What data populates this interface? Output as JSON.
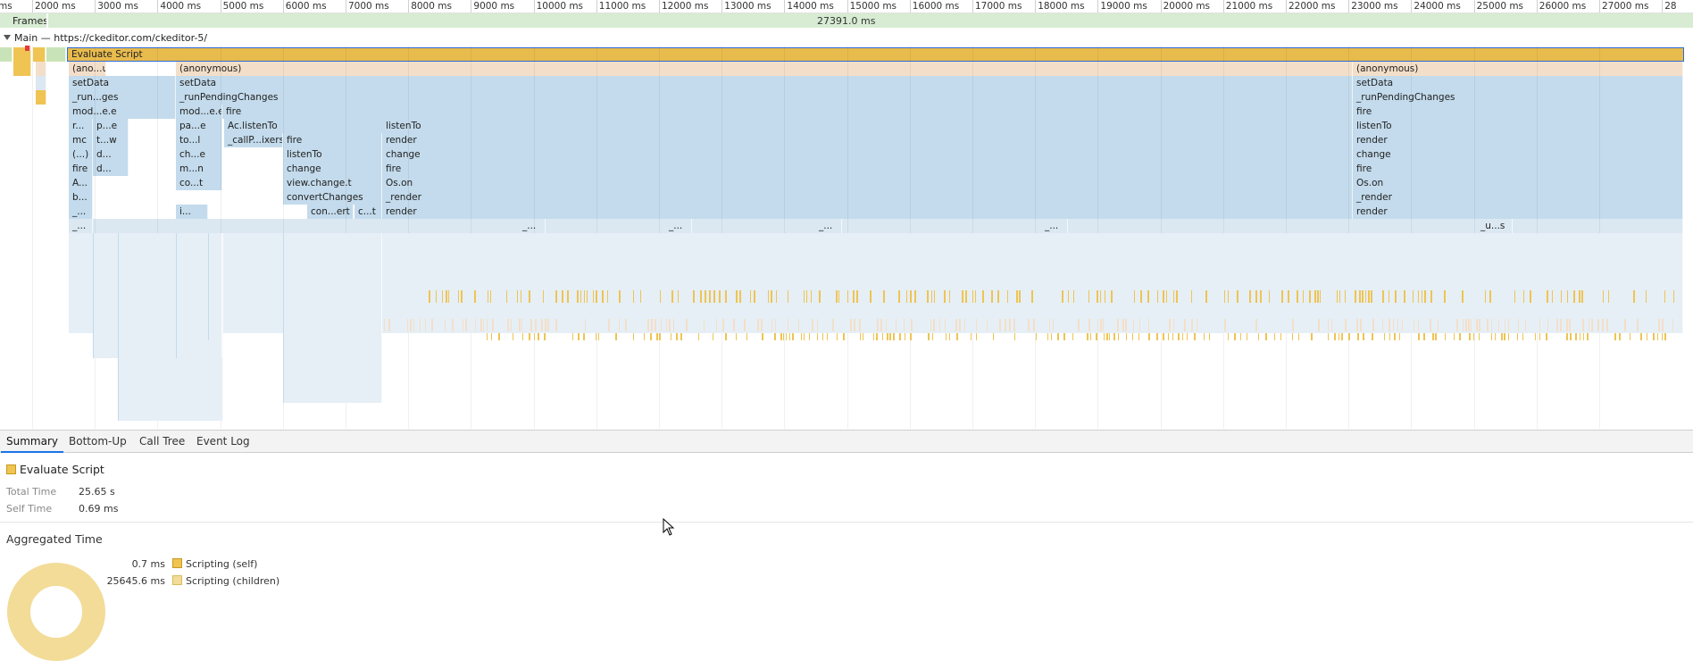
{
  "ruler": {
    "ticks": [
      "ms",
      "2000 ms",
      "3000 ms",
      "4000 ms",
      "5000 ms",
      "6000 ms",
      "7000 ms",
      "8000 ms",
      "9000 ms",
      "10000 ms",
      "11000 ms",
      "12000 ms",
      "13000 ms",
      "14000 ms",
      "15000 ms",
      "16000 ms",
      "17000 ms",
      "18000 ms",
      "19000 ms",
      "20000 ms",
      "21000 ms",
      "22000 ms",
      "23000 ms",
      "24000 ms",
      "25000 ms",
      "26000 ms",
      "27000 ms",
      "28"
    ]
  },
  "frames": {
    "label": "Frames",
    "duration": "27391.0 ms"
  },
  "main": {
    "label": "Main — https://ckeditor.com/ckeditor-5/"
  },
  "flame": {
    "evaluate_script": "Evaluate Script",
    "rows": [
      [
        "(ano...us)",
        "(anonymous)",
        "(anonymous)"
      ],
      [
        "setData",
        "setData",
        "setData"
      ],
      [
        "_run...ges",
        "_runPendingChanges",
        "_runPendingChanges"
      ],
      [
        "mod...e.e",
        "mod...e.e",
        "fire",
        "fire"
      ],
      [
        "r...",
        "p...e",
        "pa...e",
        "Ac.listenTo",
        "listenTo",
        "listenTo"
      ],
      [
        "mc",
        "t...w",
        "to...l",
        "_callP...ixers",
        "fire",
        "render",
        "render"
      ],
      [
        "(...)",
        "d...",
        "ch...e",
        "listenTo",
        "change",
        "change"
      ],
      [
        "fire",
        "d...",
        "m...n",
        "change",
        "fire",
        "fire"
      ],
      [
        "A...",
        "co...t",
        "view.change.t",
        "Os.on",
        "Os.on"
      ],
      [
        "b...",
        "convertChanges",
        "_render",
        "_render"
      ],
      [
        "_...",
        "i...",
        "con...ert",
        "c...t",
        "render",
        "render"
      ],
      [
        "_...",
        "_...",
        "_...",
        "_...",
        "_...",
        "_u...s"
      ]
    ]
  },
  "tabs": [
    "Summary",
    "Bottom-Up",
    "Call Tree",
    "Event Log"
  ],
  "summary": {
    "title": "Evaluate Script",
    "total_time_label": "Total Time",
    "total_time": "25.65 s",
    "self_time_label": "Self Time",
    "self_time": "0.69 ms",
    "aggregated_title": "Aggregated Time",
    "legend": [
      {
        "value": "0.7 ms",
        "label": "Scripting (self)",
        "color": "#efc452"
      },
      {
        "value": "25645.6 ms",
        "label": "Scripting (children)",
        "color": "#f2dc98"
      }
    ]
  },
  "colors": {
    "scripting": "#efc452",
    "scripting_light": "#f2dc98",
    "frames": "#d7ecd2",
    "call": "#c3dbec"
  }
}
